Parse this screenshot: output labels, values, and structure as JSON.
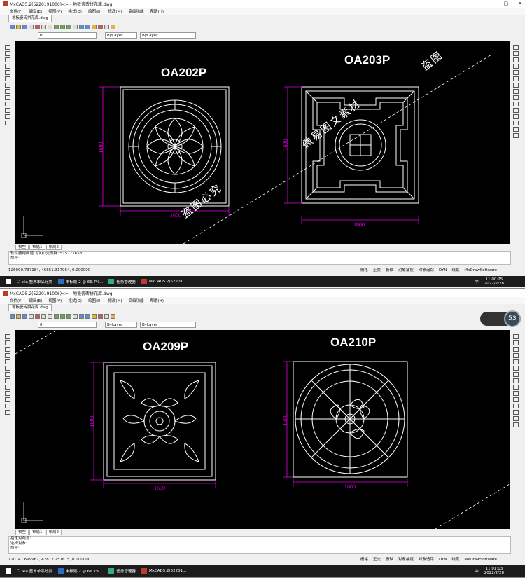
{
  "window": {
    "title_top": "MxCAD5.2(5220191006)<> - 地板瓷砖拼花库.dwg",
    "title_bottom": "MxCAD5.2(5220191006)<> - 地板瓷砖拼花库.dwg",
    "doc_tab": "地板瓷砖拼花库.dwg"
  },
  "menu": [
    "文件(F)",
    "编辑(E)",
    "视图(V)",
    "格式(O)",
    "绘图(D)",
    "修改(M)",
    "高级功能",
    "帮助(H)"
  ],
  "layer_value": "0",
  "bylayer_color": "ByLayer",
  "bylayer_line": "ByLayer",
  "layout_tabs": [
    "模型",
    "布局1",
    "布局2"
  ],
  "top": {
    "labels": [
      "OA202P",
      "OA203P"
    ],
    "dims": [
      "1600",
      "1600",
      "1600",
      "1600"
    ],
    "cmd_line1": "软件要用问题, 加QQ交流群: 515771658",
    "cmd_line2": "命令:",
    "coords": "126090.737184, 46651.317964, 0.000000",
    "clock_time": "11:00:25",
    "clock_date": "2022/2/28"
  },
  "bottom": {
    "labels": [
      "OA209P",
      "OA210P"
    ],
    "dims": [
      "1600",
      "1600",
      "1600",
      "1600"
    ],
    "cmd_line1": "指定对角点:",
    "cmd_line2": "选择对象:",
    "cmd_line3": "命令:",
    "coords": "120147.699962, 42812.251615, 0.000000",
    "clock_time": "11:01:03",
    "clock_date": "2022/2/28",
    "badge_pct": "53"
  },
  "status_items": [
    "栅格",
    "正交",
    "极轴",
    "对象捕捉",
    "对象追踪",
    "DYN",
    "线宽",
    "MxDrawSoftware"
  ],
  "taskbar": {
    "search": "xia 整木单品分类",
    "ps_top": "未标题-2 @ 66.7%...",
    "task_mgr": "任务管理器",
    "mxcad": "MxCAD5.2(52201..."
  },
  "tray": {
    "input": "中"
  },
  "watermarks": [
    "盗图必究",
    "微易图文素材",
    "盗图"
  ],
  "colors": {
    "canvas": "#000000",
    "dimension": "#e000e0",
    "drawing": "#ffffff",
    "cyan_text": "#00ffff"
  }
}
